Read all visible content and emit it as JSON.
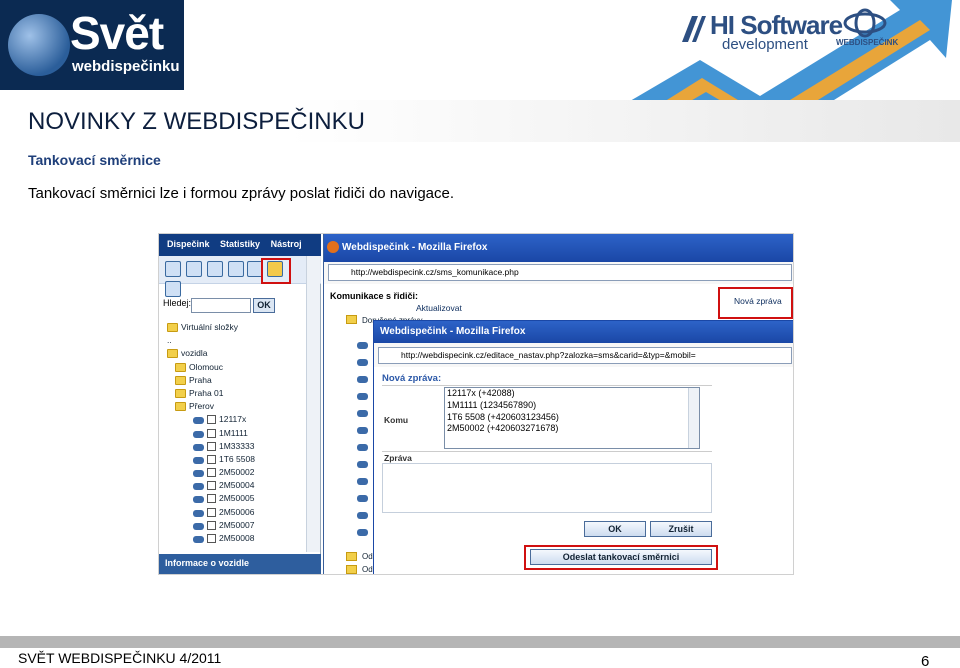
{
  "header": {
    "brand_main": "Svět",
    "brand_sub": "webdispečinku",
    "partner_name": "HI Software",
    "partner_sub": "development",
    "partner2_name": "WEBDISPEČINK"
  },
  "title": "NOVINKY Z WEBDISPEČINKU",
  "subtitle": "Tankovací směrnice",
  "body_text": "Tankovací směrnici lze i formou zprávy poslat řidiči do navigace.",
  "screenshot": {
    "left_panel": {
      "menu": [
        "Dispečink",
        "Statistiky",
        "Nástroj"
      ],
      "search_label": "Hledej:",
      "ok_label": "OK",
      "tree": [
        {
          "type": "folder",
          "label": "Virtuální složky",
          "indent": 0
        },
        {
          "type": "text",
          "label": "..",
          "indent": 0
        },
        {
          "type": "folder",
          "label": "vozidla",
          "indent": 0
        },
        {
          "type": "folder",
          "label": "Olomouc",
          "indent": 1
        },
        {
          "type": "folder",
          "label": "Praha",
          "indent": 1
        },
        {
          "type": "folder",
          "label": "Praha 01",
          "indent": 1
        },
        {
          "type": "folder",
          "label": "Přerov",
          "indent": 1
        },
        {
          "type": "vehicle",
          "label": "12117x",
          "indent": 2
        },
        {
          "type": "vehicle",
          "label": "1M1111",
          "indent": 2
        },
        {
          "type": "vehicle",
          "label": "1M33333",
          "indent": 2
        },
        {
          "type": "vehicle",
          "label": "1T6 5508",
          "indent": 2
        },
        {
          "type": "vehicle",
          "label": "2M50002",
          "indent": 2
        },
        {
          "type": "vehicle",
          "label": "2M50004",
          "indent": 2
        },
        {
          "type": "vehicle",
          "label": "2M50005",
          "indent": 2
        },
        {
          "type": "vehicle",
          "label": "2M50006",
          "indent": 2
        },
        {
          "type": "vehicle",
          "label": "2M50007",
          "indent": 2
        },
        {
          "type": "vehicle",
          "label": "2M50008",
          "indent": 2
        }
      ],
      "footer": "Informace o vozidle"
    },
    "window1": {
      "title": "Webdispečink - Mozilla Firefox",
      "url": "http://webdispecink.cz/sms_komunikace.php",
      "section": "Komunikace s řidiči:",
      "refresh": "Aktualizovat",
      "new_message": "Nová zpráva",
      "tree_top": "Doručené zprávy",
      "tree_bottom": [
        "Odes",
        "Odes"
      ]
    },
    "window2": {
      "title": "Webdispečink - Mozilla Firefox",
      "url": "http://webdispecink.cz/editace_nastav.php?zalozka=sms&carid=&typ=&mobil=",
      "heading": "Nová zpráva:",
      "to_label": "Komu",
      "recipients": [
        "12117x (+42088)",
        "1M1111 (1234567890)",
        "1T6 5508 (+420603123456)",
        "2M50002 (+420603271678)"
      ],
      "message_label": "Zpráva",
      "ok_label": "OK",
      "cancel_label": "Zrušit",
      "send_label": "Odeslat tankovací směrnici"
    }
  },
  "footer": {
    "text": "SVĚT WEBDISPEČINKU 4/2011",
    "page": "6"
  },
  "colors": {
    "title": "#0c1e3d",
    "subtitle": "#1f3f7a",
    "highlight": "#d01010",
    "arrow": "#2f8ad0"
  }
}
